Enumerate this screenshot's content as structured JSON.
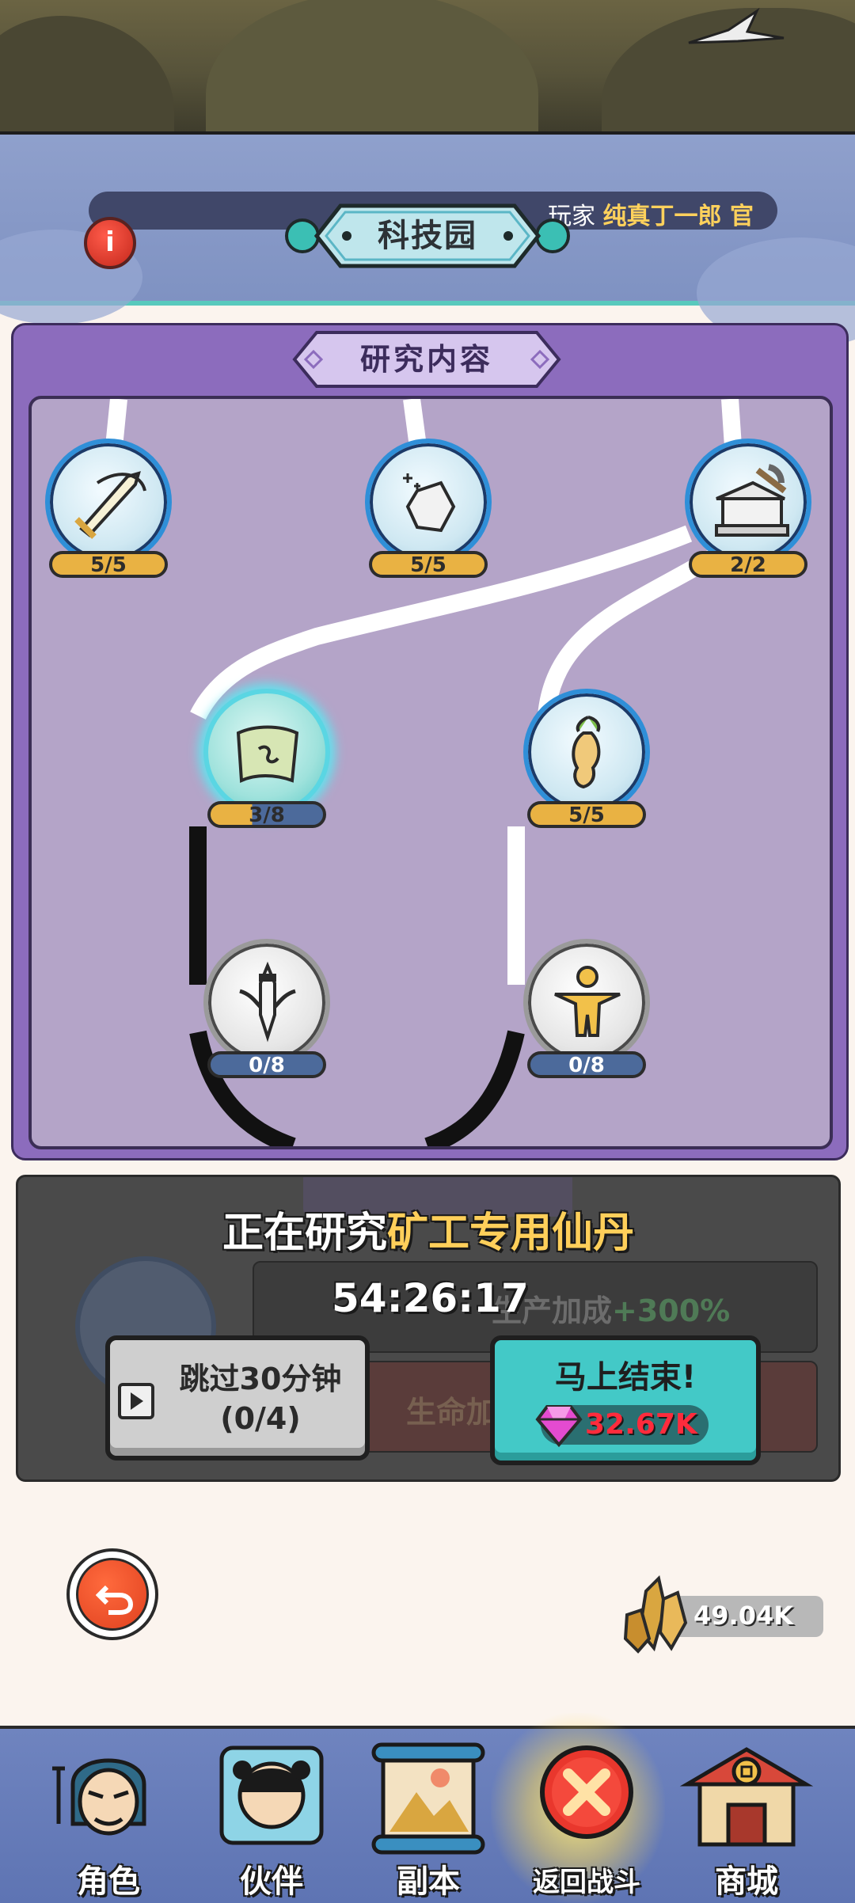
{
  "header": {
    "title": "科技园",
    "player_prefix": "玩家",
    "player_name": "纯真丁一郎 官"
  },
  "research_panel": {
    "title": "研究内容",
    "nodes": [
      {
        "id": "sword",
        "level": "5/5",
        "state": "complete",
        "icon": "sword-icon"
      },
      {
        "id": "ore",
        "level": "5/5",
        "state": "complete",
        "icon": "ore-icon"
      },
      {
        "id": "mine-temple",
        "level": "2/2",
        "state": "complete",
        "icon": "pickaxe-temple-icon"
      },
      {
        "id": "scroll",
        "level": "3/8",
        "state": "researching",
        "icon": "scroll-icon"
      },
      {
        "id": "ginseng",
        "level": "5/5",
        "state": "complete",
        "icon": "ginseng-icon"
      },
      {
        "id": "dagger",
        "level": "0/8",
        "state": "locked",
        "icon": "dagger-icon"
      },
      {
        "id": "golden-body",
        "level": "0/8",
        "state": "locked",
        "icon": "golden-body-icon"
      }
    ]
  },
  "status": {
    "prefix": "正在研究",
    "subject": "矿工专用仙丹",
    "timer": "54:26:17",
    "effect1_label": "生产加成",
    "effect1_value": "+300%",
    "effect2_label": "生命加",
    "skip_line1": "跳过30分钟",
    "skip_line2": "(0/4)",
    "finish_label": "马上结束!",
    "finish_cost": "32.67K"
  },
  "resources": {
    "crystal": "49.04K"
  },
  "nav": [
    {
      "label": "角色",
      "icon": "character-icon"
    },
    {
      "label": "伙伴",
      "icon": "partner-icon"
    },
    {
      "label": "副本",
      "icon": "dungeon-scroll-icon"
    },
    {
      "label": "返回战斗",
      "icon": "close-x-icon",
      "active": true
    },
    {
      "label": "商城",
      "icon": "shop-icon"
    }
  ],
  "colors": {
    "panel_purple": "#8c6cbd",
    "accent_teal": "#43c9c7",
    "level_gold": "#e9b243",
    "gem_red": "#ff2b3c"
  }
}
